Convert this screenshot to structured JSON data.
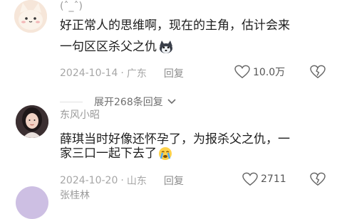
{
  "comments": [
    {
      "username": "(ˆ_ˆ)",
      "text_line1": "好正常人的思维啊，现在的主角，估计会来",
      "text_line2": "一句区区杀父之仇",
      "date": "2024-10-14",
      "location": "广东",
      "reply_label": "回复",
      "like_count": "10.0万"
    },
    {
      "username": "东风小昭",
      "text_line1": "薛琪当时好像还怀孕了，为报杀父之仇，一",
      "text_line2": "家三口一起下去了",
      "date": "2024-10-20",
      "location": "山东",
      "reply_label": "回复",
      "like_count": "2711"
    },
    {
      "username": "张桂林"
    }
  ],
  "expand_replies_label": "展开268条回复",
  "colors": {
    "text": "#1d1d1d",
    "meta": "#a6a6a6"
  }
}
